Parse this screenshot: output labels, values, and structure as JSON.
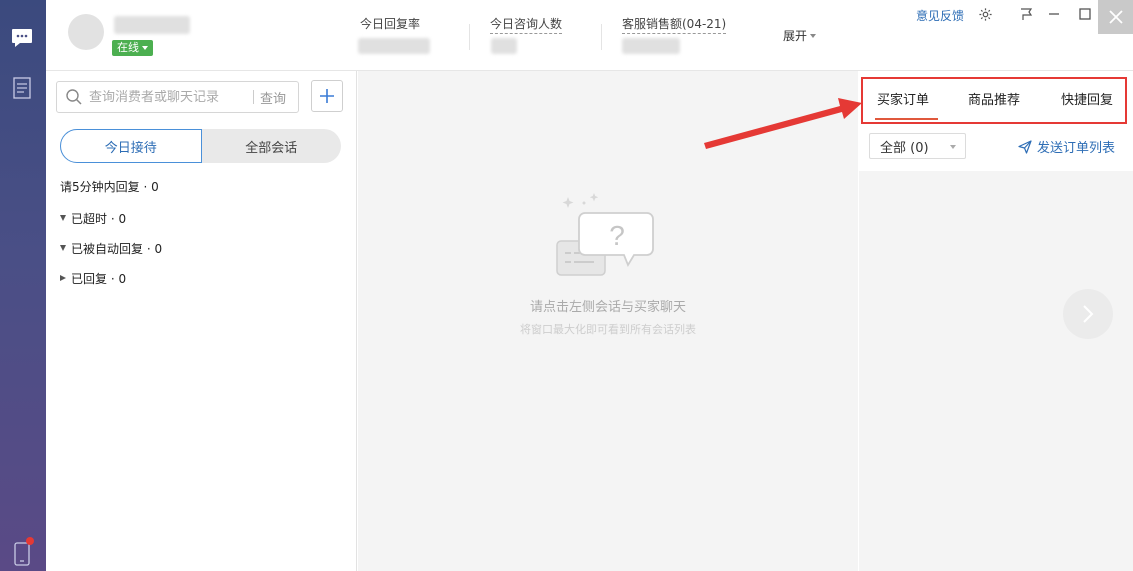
{
  "header": {
    "status_label": "在线",
    "stats": [
      {
        "label": "今日回复率"
      },
      {
        "label": "今日咨询人数"
      },
      {
        "label": "客服销售额(04-21)"
      }
    ],
    "expand_label": "展开",
    "feedback_label": "意见反馈"
  },
  "left_panel": {
    "search_placeholder": "查询消费者或聊天记录",
    "search_button": "查询",
    "tabs": [
      {
        "label": "今日接待",
        "active": true
      },
      {
        "label": "全部会话",
        "active": false
      }
    ],
    "conversation_groups": [
      {
        "label": "请5分钟内回复 · 0"
      },
      {
        "label": "已超时 · 0",
        "expanded": true
      },
      {
        "label": "已被自动回复 · 0",
        "expanded": true
      },
      {
        "label": "已回复 · 0",
        "expanded": false
      }
    ]
  },
  "main": {
    "empty_title": "请点击左侧会话与买家聊天",
    "empty_hint": "将窗口最大化即可看到所有会话列表"
  },
  "right_panel": {
    "tabs": [
      {
        "label": "买家订单",
        "active": true
      },
      {
        "label": "商品推荐",
        "active": false
      },
      {
        "label": "快捷回复",
        "active": false
      }
    ],
    "filter_value": "全部 (0)",
    "send_link": "发送订单列表"
  },
  "colors": {
    "accent_blue": "#2d6db5",
    "online_green": "#4caf50",
    "annotation_red": "#e53935",
    "rail_top": "#3b4a7e",
    "rail_bottom": "#5a4a86"
  },
  "icons": [
    "chat-icon",
    "document-icon",
    "phone-icon",
    "settings-icon",
    "pin-icon",
    "minimize-icon",
    "maximize-icon",
    "close-icon",
    "search-icon",
    "plus-icon",
    "send-icon",
    "chevron-right-icon"
  ]
}
